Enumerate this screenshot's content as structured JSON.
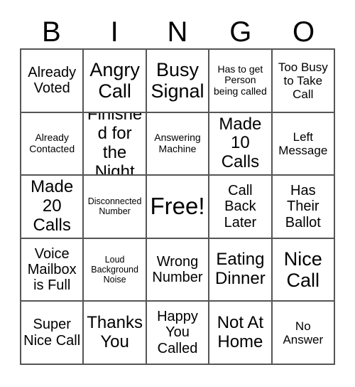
{
  "card": {
    "title_letters": [
      "B",
      "I",
      "N",
      "G",
      "O"
    ],
    "free_space_label": "Free!",
    "colors": {
      "background": "#ffffff",
      "grid_line": "#555555",
      "text": "#000000"
    },
    "rows": [
      [
        {
          "text": "Already Voted",
          "size": "fs-lg"
        },
        {
          "text": "Angry Call",
          "size": "fs-xxl"
        },
        {
          "text": "Busy Signal",
          "size": "fs-xxl"
        },
        {
          "text": "Has to get Person being called",
          "size": "fs-sm"
        },
        {
          "text": "Too Busy to Take Call",
          "size": "fs-md"
        }
      ],
      [
        {
          "text": "Already Contacted",
          "size": "fs-sm"
        },
        {
          "text": "Finished for the Night",
          "size": "fs-xl"
        },
        {
          "text": "Answering Machine",
          "size": "fs-sm"
        },
        {
          "text": "Made 10 Calls",
          "size": "fs-xl"
        },
        {
          "text": "Left Message",
          "size": "fs-md"
        }
      ],
      [
        {
          "text": "Made 20 Calls",
          "size": "fs-xl"
        },
        {
          "text": "Disconnected Number",
          "size": "fs-xs"
        },
        {
          "text": "Free!",
          "size": "fs-free"
        },
        {
          "text": "Call Back Later",
          "size": "fs-lg"
        },
        {
          "text": "Has Their Ballot",
          "size": "fs-lg"
        }
      ],
      [
        {
          "text": "Voice Mailbox is Full",
          "size": "fs-lg"
        },
        {
          "text": "Loud Background Noise",
          "size": "fs-xs"
        },
        {
          "text": "Wrong Number",
          "size": "fs-lg"
        },
        {
          "text": "Eating Dinner",
          "size": "fs-xl"
        },
        {
          "text": "Nice Call",
          "size": "fs-xxl"
        }
      ],
      [
        {
          "text": "Super Nice Call",
          "size": "fs-lg"
        },
        {
          "text": "Thanks You",
          "size": "fs-xl"
        },
        {
          "text": "Happy You Called",
          "size": "fs-lg"
        },
        {
          "text": "Not At Home",
          "size": "fs-xl"
        },
        {
          "text": "No Answer",
          "size": "fs-md"
        }
      ]
    ]
  }
}
